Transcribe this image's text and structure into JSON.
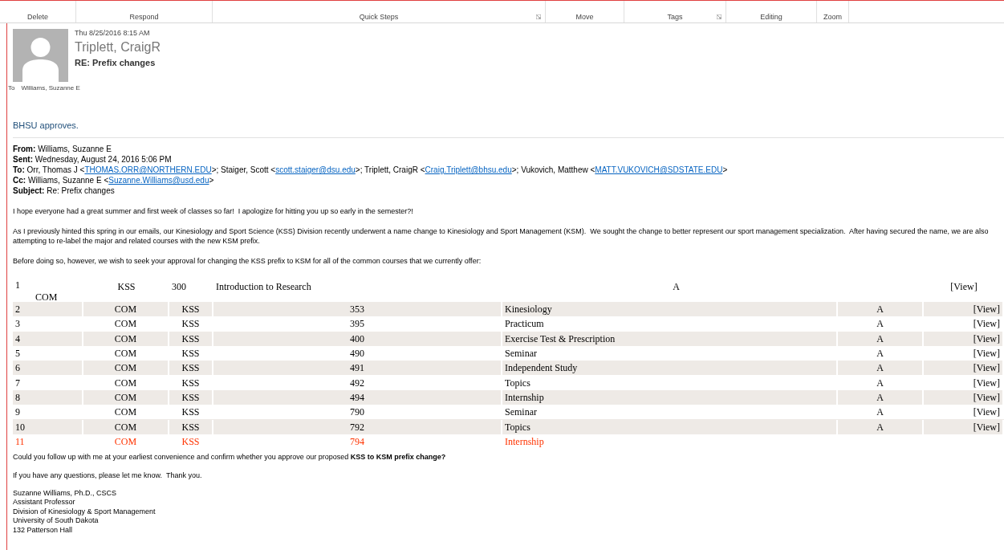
{
  "ribbon": {
    "groups": [
      {
        "label": "Delete",
        "launcher": false
      },
      {
        "label": "Respond",
        "launcher": false
      },
      {
        "label": "Quick Steps",
        "launcher": true
      },
      {
        "label": "Move",
        "launcher": false
      },
      {
        "label": "Tags",
        "launcher": true
      },
      {
        "label": "Editing",
        "launcher": false
      },
      {
        "label": "Zoom",
        "launcher": false
      }
    ]
  },
  "message": {
    "date": "Thu 8/25/2016 8:15 AM",
    "sender": "Triplett, CraigR",
    "subject": "RE: Prefix changes",
    "to_label": "To",
    "to": "Williams, Suzanne E",
    "reply": "BHSU approves."
  },
  "quoted": {
    "headers": [
      {
        "label": "From:",
        "segments": [
          {
            "kind": "text",
            "text": "Williams, Suzanne E"
          }
        ]
      },
      {
        "label": "Sent:",
        "segments": [
          {
            "kind": "text",
            "text": "Wednesday, August 24, 2016 5:06 PM"
          }
        ]
      },
      {
        "label": "To:",
        "segments": [
          {
            "kind": "text",
            "text": "Orr, Thomas J <"
          },
          {
            "kind": "link",
            "text": "THOMAS.ORR@NORTHERN.EDU"
          },
          {
            "kind": "text",
            "text": ">; Staiger, Scott <"
          },
          {
            "kind": "link",
            "text": "scott.staiger@dsu.edu"
          },
          {
            "kind": "text",
            "text": ">; Triplett, CraigR <"
          },
          {
            "kind": "link",
            "text": "Craig.Triplett@bhsu.edu"
          },
          {
            "kind": "text",
            "text": ">; Vukovich, Matthew <"
          },
          {
            "kind": "link",
            "text": "MATT.VUKOVICH@SDSTATE.EDU"
          },
          {
            "kind": "text",
            "text": ">"
          }
        ]
      },
      {
        "label": "Cc:",
        "segments": [
          {
            "kind": "text",
            "text": "Williams, Suzanne E <"
          },
          {
            "kind": "link",
            "text": "Suzanne.Williams@usd.edu"
          },
          {
            "kind": "text",
            "text": ">"
          }
        ]
      },
      {
        "label": "Subject:",
        "segments": [
          {
            "kind": "text",
            "text": "Re: Prefix changes"
          }
        ]
      }
    ],
    "paragraphs": [
      "I hope everyone had a great summer and first week of classes so far!  I apologize for hitting you up so early in the semester?!",
      "As I previously hinted this spring in our emails, our Kinesiology and Sport Science (KSS) Division recently underwent a name change to Kinesiology and Sport Management (KSM).  We sought the change to better represent our sport management specialization.  After having secured the name, we are also attempting to re-label the major and related courses with the new KSM prefix.",
      "Before doing so, however, we wish to seek your approval for changing the KSS prefix to KSM for all of the common courses that we currently offer:"
    ],
    "table": {
      "misaligned_row": {
        "number": "1",
        "cells": [
          "COM",
          "KSS",
          "300",
          "Introduction to Research",
          "A",
          "[View]"
        ]
      },
      "rows": [
        {
          "kind": "normal",
          "cells": [
            "2",
            "COM",
            "KSS",
            "353",
            "Kinesiology",
            "A",
            "[View]"
          ]
        },
        {
          "kind": "normal",
          "cells": [
            "3",
            "COM",
            "KSS",
            "395",
            "Practicum",
            "A",
            "[View]"
          ]
        },
        {
          "kind": "normal",
          "cells": [
            "4",
            "COM",
            "KSS",
            "400",
            "Exercise Test & Prescription",
            "A",
            "[View]"
          ]
        },
        {
          "kind": "normal",
          "cells": [
            "5",
            "COM",
            "KSS",
            "490",
            "Seminar",
            "A",
            "[View]"
          ]
        },
        {
          "kind": "normal",
          "cells": [
            "6",
            "COM",
            "KSS",
            "491",
            "Independent Study",
            "A",
            "[View]"
          ]
        },
        {
          "kind": "normal",
          "cells": [
            "7",
            "COM",
            "KSS",
            "492",
            "Topics",
            "A",
            "[View]"
          ]
        },
        {
          "kind": "normal",
          "cells": [
            "8",
            "COM",
            "KSS",
            "494",
            "Internship",
            "A",
            "[View]"
          ]
        },
        {
          "kind": "normal",
          "cells": [
            "9",
            "COM",
            "KSS",
            "790",
            "Seminar",
            "A",
            "[View]"
          ]
        },
        {
          "kind": "normal",
          "cells": [
            "10",
            "COM",
            "KSS",
            "792",
            "Topics",
            "A",
            "[View]"
          ]
        },
        {
          "kind": "flagged",
          "cells": [
            "11",
            "COM",
            "KSS",
            "794",
            "Internship"
          ]
        }
      ]
    },
    "closing": [
      "Could you follow up with me at your earliest convenience and confirm whether you approve our proposed **KSS to KSM prefix change?**",
      "If you have any questions, please let me know.  Thank you."
    ],
    "signature": [
      "Suzanne Williams, Ph.D., CSCS",
      "Assistant Professor",
      "Division of Kinesiology & Sport Management",
      "University of South Dakota",
      "132 Patterson Hall"
    ]
  }
}
